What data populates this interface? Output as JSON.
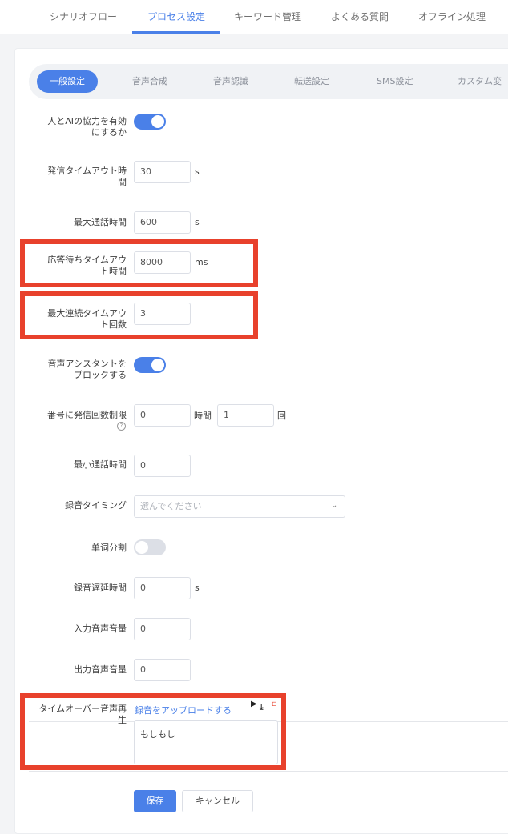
{
  "topnav": {
    "tabs": [
      {
        "label": "シナリオフロー",
        "active": false
      },
      {
        "label": "プロセス設定",
        "active": true
      },
      {
        "label": "キーワード管理",
        "active": false
      },
      {
        "label": "よくある質問",
        "active": false
      },
      {
        "label": "オフライン処理",
        "active": false
      }
    ]
  },
  "subtabs": [
    {
      "label": "一般設定",
      "active": true
    },
    {
      "label": "音声合成",
      "active": false
    },
    {
      "label": "音声認識",
      "active": false
    },
    {
      "label": "転送設定",
      "active": false
    },
    {
      "label": "SMS設定",
      "active": false
    },
    {
      "label": "カスタム変",
      "active": false
    }
  ],
  "form": {
    "human_ai": {
      "label_line1": "人とAIの協力を有効",
      "label_line2": "にするか",
      "enabled": true
    },
    "call_timeout": {
      "label_line1": "発信タイムアウト時",
      "label_line2": "間",
      "value": "30",
      "unit": "s"
    },
    "max_call_time": {
      "label": "最大通話時間",
      "value": "600",
      "unit": "s"
    },
    "answer_wait": {
      "label_line1": "応答待ちタイムアウ",
      "label_line2": "ト時間",
      "value": "8000",
      "unit": "ms"
    },
    "max_consecutive": {
      "label_line1": "最大連続タイムアウ",
      "label_line2": "ト回数",
      "value": "3"
    },
    "block_assistant": {
      "label_line1": "音声アシスタントを",
      "label_line2": "ブロックする",
      "enabled": true
    },
    "call_limit": {
      "label": "番号に発信回数制限",
      "help_icon": "?",
      "hours_value": "0",
      "hours_unit": "時間",
      "count_value": "1",
      "count_unit": "回"
    },
    "min_call_time": {
      "label": "最小通話時間",
      "value": "0"
    },
    "record_timing": {
      "label": "録音タイミング",
      "placeholder": "選んでください"
    },
    "word_split": {
      "label": "单词分割",
      "enabled": false
    },
    "record_delay": {
      "label": "録音遅延時間",
      "value": "0",
      "unit": "s"
    },
    "input_volume": {
      "label": "入力音声音量",
      "value": "0"
    },
    "output_volume": {
      "label": "出力音声音量",
      "value": "0"
    },
    "timeover_play": {
      "label_line1": "タイムオーバー音声再",
      "label_line2": "生",
      "upload_link": "録音をアップロードする",
      "text": "もしもし"
    }
  },
  "actions": {
    "save": "保存",
    "cancel": "キャンセル"
  },
  "colors": {
    "accent": "#4a80e8",
    "highlight": "#e8412c"
  }
}
